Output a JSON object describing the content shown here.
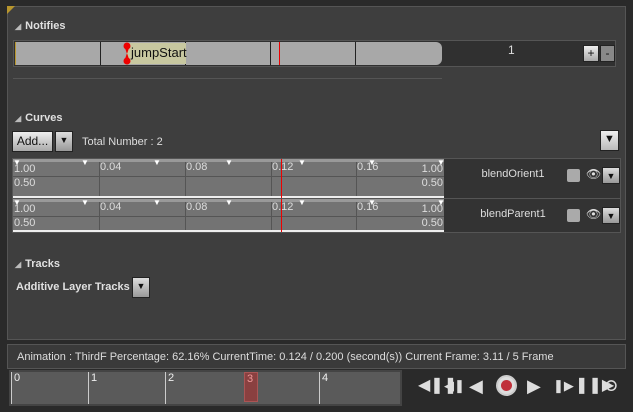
{
  "notifies": {
    "title": "Notifies",
    "notify_name": "jumpStart",
    "track_number": "1",
    "add_label": "+",
    "remove_label": "-"
  },
  "curves": {
    "title": "Curves",
    "add_label": "Add...",
    "total": "Total Number : 2",
    "ticks": [
      "0.04",
      "0.08",
      "0.12",
      "0.16"
    ],
    "min_label": "0.50",
    "max_label": "1.00",
    "top_left": "1.00",
    "bottom_left": "0.50",
    "items": [
      {
        "name": "blendOrient1"
      },
      {
        "name": "blendParent1"
      }
    ]
  },
  "tracks": {
    "title": "Tracks",
    "additive_label": "Additive Layer Tracks"
  },
  "status": {
    "text": "Animation :  ThirdF Percentage:  62.16% CurrentTime:  0.124 / 0.200 (second(s)) Current Frame:  3.11 / 5 Frame"
  },
  "scrubber": {
    "frames": [
      "0",
      "1",
      "2",
      "3",
      "4"
    ],
    "current_frame": 3,
    "playhead_percent": 62.16
  },
  "colors": {
    "accent": "#b8962e",
    "playhead": "#e00000",
    "record": "#c0303a"
  }
}
